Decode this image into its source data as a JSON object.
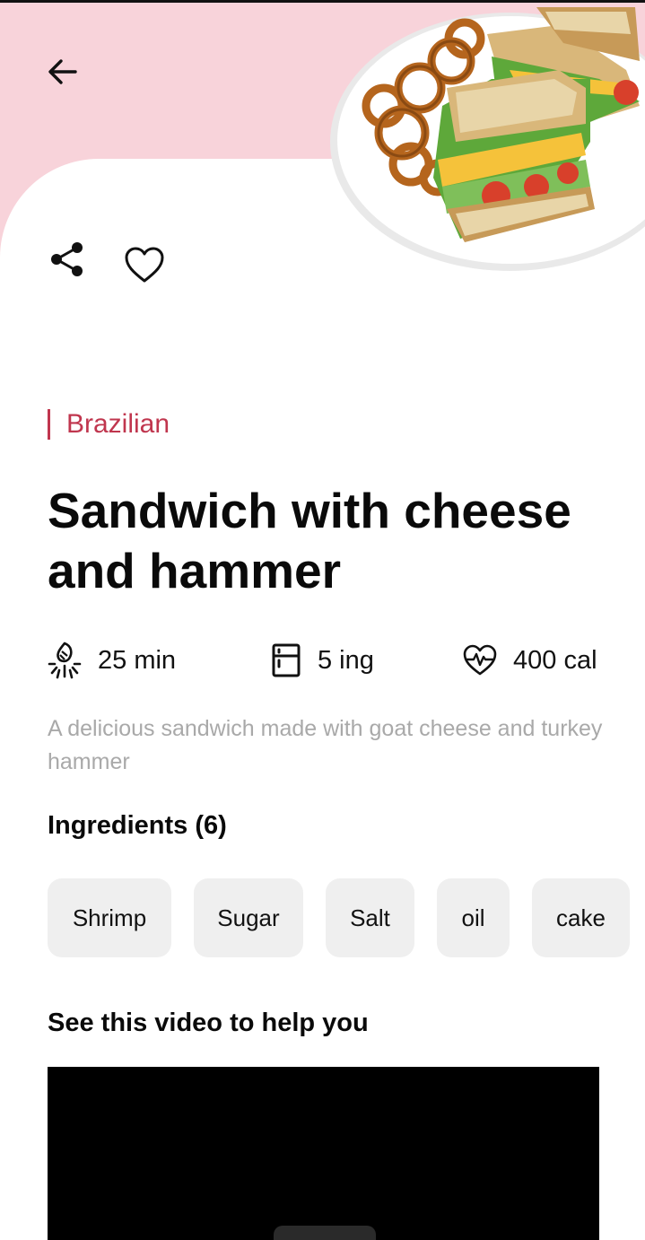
{
  "category": "Brazilian",
  "title": "Sandwich with cheese and hammer",
  "stats": {
    "time": "25 min",
    "ingredients": "5 ing",
    "calories": "400 cal"
  },
  "description": "A delicious sandwich made with goat cheese and turkey hammer",
  "ingredients_section": {
    "title": "Ingredients (6)",
    "chips": [
      "Shrimp",
      "Sugar",
      "Salt",
      "oil",
      "cake"
    ]
  },
  "video_section": {
    "title": "See this video to help you"
  },
  "icons": {
    "back": "arrow-left-icon",
    "share": "share-icon",
    "favorite": "heart-outline-icon",
    "time": "cooking-time-icon",
    "ingredients": "fridge-icon",
    "calories": "heart-pulse-icon"
  },
  "colors": {
    "hero_background": "#f8d3da",
    "accent": "#c0364e",
    "muted_text": "#a9a9a9",
    "chip_background": "#efefef"
  }
}
